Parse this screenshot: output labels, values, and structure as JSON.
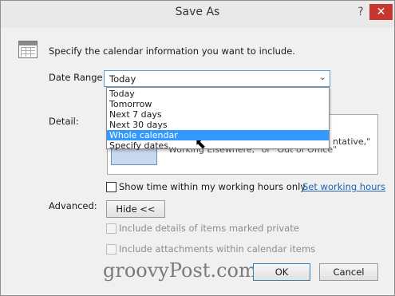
{
  "window": {
    "title": "Save As",
    "help_icon": "?",
    "close_icon": "✕"
  },
  "intro_text": "Specify the calendar information you want to include.",
  "date_range": {
    "label": "Date Range:",
    "selected": "Today",
    "options": [
      "Today",
      "Tomorrow",
      "Next 7 days",
      "Next 30 days",
      "Whole calendar",
      "Specify dates..."
    ],
    "highlighted": "Whole calendar"
  },
  "detail": {
    "label": "Detail:",
    "visible_text_tail": "ntative,\"",
    "visible_text_hidden": "Working Elsewhere,\" or \"Out of Office\""
  },
  "working_hours": {
    "checkbox_label": "Show time within my working hours only",
    "checked": false,
    "link": "Set working hours"
  },
  "advanced": {
    "label": "Advanced:",
    "toggle_button": "Hide <<",
    "private_checkbox": "Include details of items marked private",
    "attachments_checkbox": "Include attachments within calendar items"
  },
  "buttons": {
    "ok": "OK",
    "cancel": "Cancel"
  },
  "watermark": "groovyPost.com",
  "colors": {
    "link": "#1e64b4",
    "selection": "#3399ff",
    "close_button": "#c7372f"
  }
}
